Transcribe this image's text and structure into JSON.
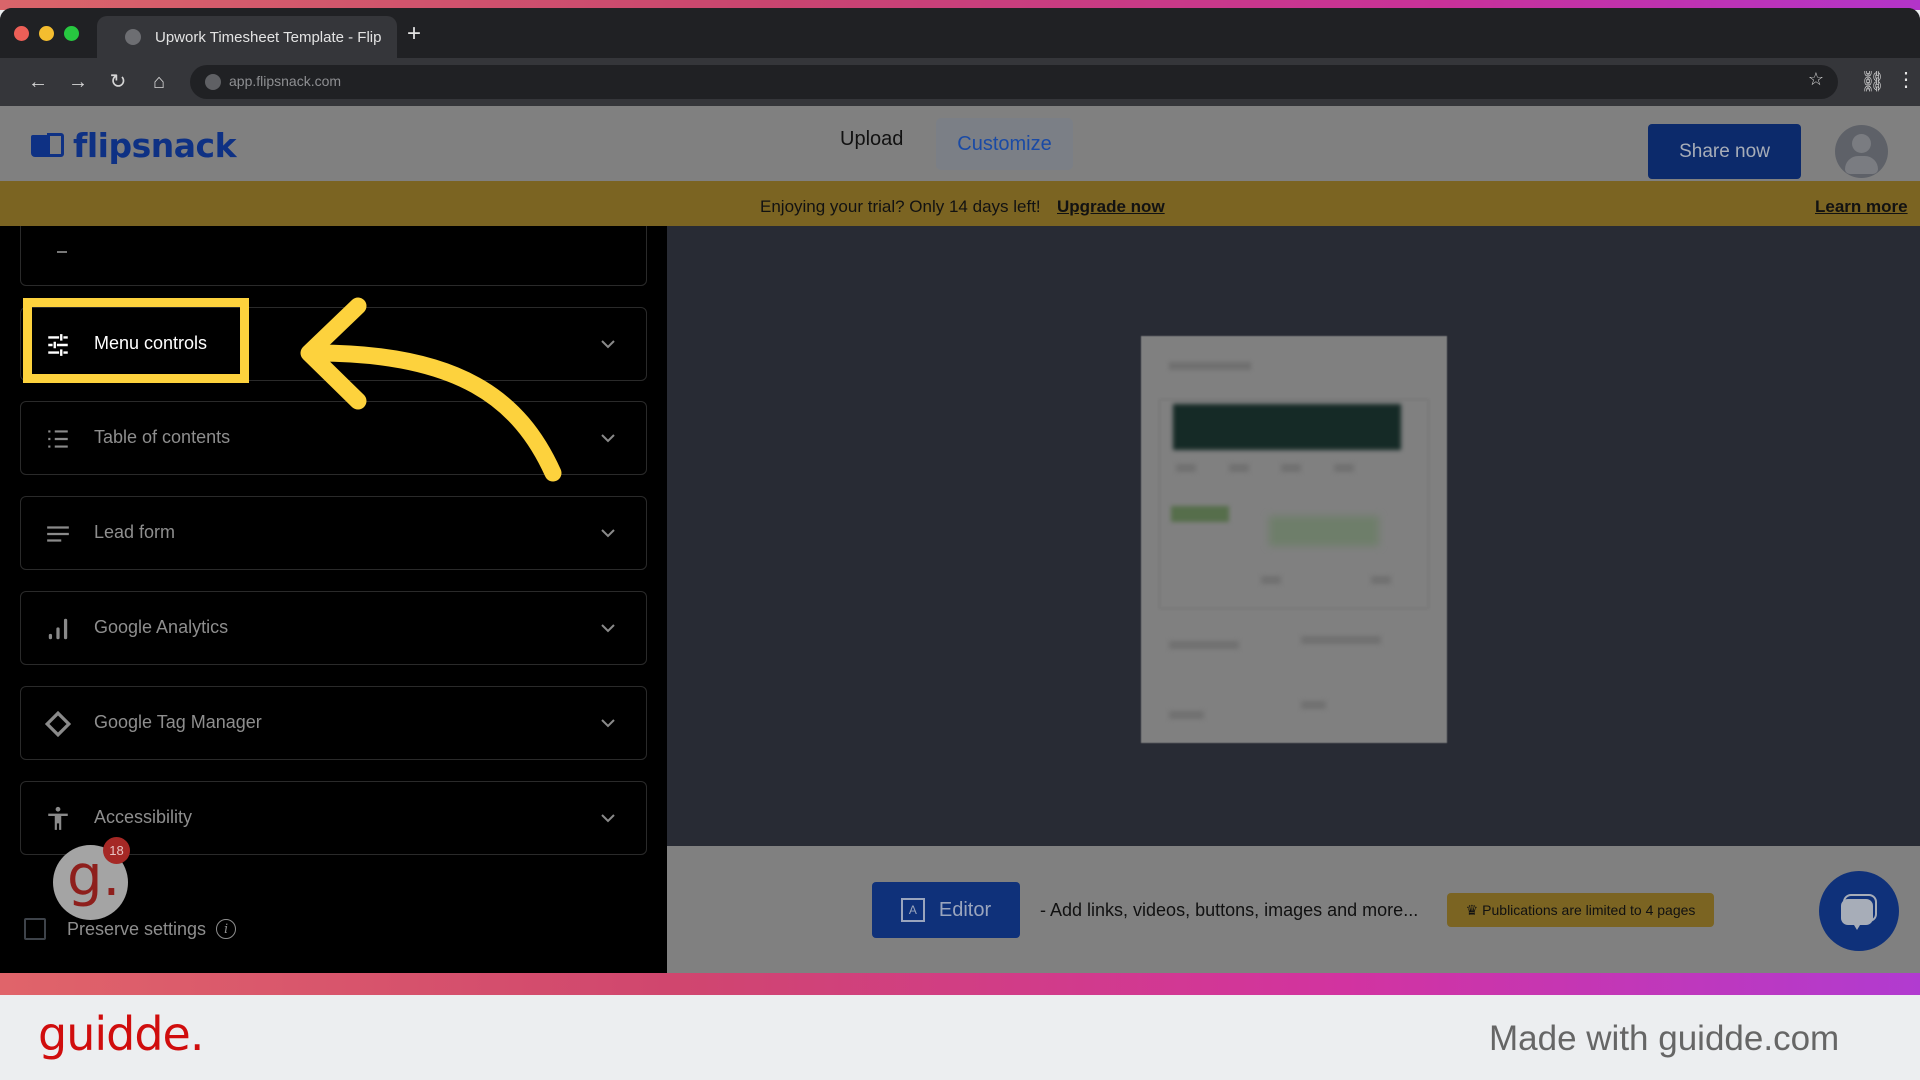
{
  "browser": {
    "tab_title": "Upwork Timesheet Template - Flip",
    "url": "app.flipsnack.com",
    "icons": [
      "back-icon",
      "forward-icon",
      "reload-icon",
      "home-icon",
      "globe-icon",
      "star-icon",
      "extensions-icon",
      "kebab-menu-icon"
    ]
  },
  "header": {
    "logo_text": "flipsnack",
    "nav": {
      "upload": "Upload",
      "customize": "Customize"
    },
    "share_label": "Share now",
    "brand_color": "#0e3184"
  },
  "trial_banner": {
    "message": "Enjoying your trial? Only 14 days left!",
    "upgrade_link": "Upgrade now",
    "learn_more_link": "Learn more"
  },
  "sidebar": {
    "items": [
      {
        "label": "Menu controls",
        "icon": "sliders-icon",
        "active": true
      },
      {
        "label": "Table of contents",
        "icon": "list-icon",
        "active": false
      },
      {
        "label": "Lead form",
        "icon": "lines-icon",
        "active": false
      },
      {
        "label": "Google Analytics",
        "icon": "bar-chart-icon",
        "active": false
      },
      {
        "label": "Google Tag Manager",
        "icon": "diamond-icon",
        "active": false
      },
      {
        "label": "Accessibility",
        "icon": "accessibility-icon",
        "active": false
      }
    ],
    "preserve_label": "Preserve settings",
    "preserve_checked": false,
    "info_glyph": "i"
  },
  "guidde_badge": {
    "glyph": "g.",
    "count": "18"
  },
  "bottom_bar": {
    "editor_label": "Editor",
    "editor_glyph": "A",
    "description": "- Add links, videos, buttons, images and more...",
    "limit_text": "Publications are limited to 4 pages",
    "crown_glyph": "♛"
  },
  "footer": {
    "brand": "guidde.",
    "made_with": "Made with guidde.com"
  },
  "annotation": {
    "highlight_color": "#fdd23d",
    "target": "Menu controls"
  }
}
